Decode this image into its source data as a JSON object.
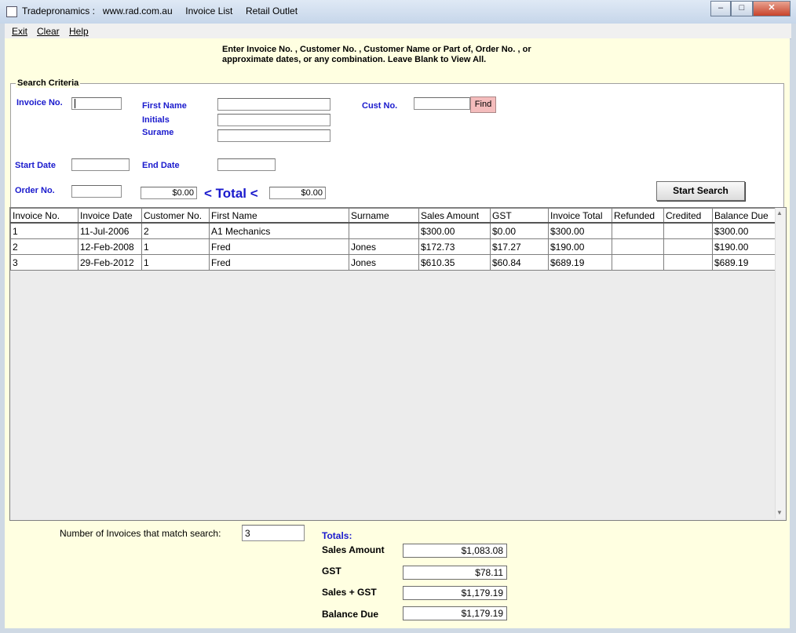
{
  "window": {
    "title": "Tradepronamics :   www.rad.com.au     Invoice List     Retail Outlet",
    "minimize_glyph": "–",
    "maximize_glyph": "□",
    "close_glyph": "✕"
  },
  "menu": {
    "items": [
      "Exit",
      "Clear",
      "Help"
    ]
  },
  "instructions": "Enter Invoice No. , Customer No. , Customer Name or Part of, Order No. , or approximate dates, or any combination. Leave Blank to View All.",
  "search_criteria": {
    "legend": "Search Criteria",
    "invoice_no_label": "Invoice No.",
    "first_name_label": "First Name",
    "initials_label": "Initials",
    "surname_label": "Surame",
    "cust_no_label": "Cust No.",
    "find_label": "Find",
    "start_date_label": "Start Date",
    "end_date_label": "End Date",
    "order_no_label": "Order No.",
    "total_from": "$0.00",
    "total_label": "< Total <",
    "total_to": "$0.00",
    "start_search_label": "Start Search"
  },
  "grid": {
    "columns": [
      "Invoice No.",
      "Invoice Date",
      "Customer No.",
      "First Name",
      "Surname",
      "Sales Amount",
      "GST",
      "Invoice Total",
      "Refunded",
      "Credited",
      "Balance Due"
    ],
    "rows": [
      [
        "1",
        "11-Jul-2006",
        "2",
        "A1 Mechanics",
        "",
        "$300.00",
        "$0.00",
        "$300.00",
        "",
        "",
        "$300.00"
      ],
      [
        "2",
        "12-Feb-2008",
        "1",
        "Fred",
        "Jones",
        "$172.73",
        "$17.27",
        "$190.00",
        "",
        "",
        "$190.00"
      ],
      [
        "3",
        "29-Feb-2012",
        "1",
        "Fred",
        "Jones",
        "$610.35",
        "$60.84",
        "$689.19",
        "",
        "",
        "$689.19"
      ]
    ]
  },
  "summary": {
    "count_label": "Number of Invoices that match search:",
    "count_value": "3",
    "totals_heading": "Totals:",
    "sales_amount_label": "Sales Amount",
    "sales_amount": "$1,083.08",
    "gst_label": "GST",
    "gst": "$78.11",
    "sales_gst_label": "Sales + GST",
    "sales_gst": "$1,179.19",
    "balance_due_label": "Balance Due",
    "balance_due": "$1,179.19"
  }
}
